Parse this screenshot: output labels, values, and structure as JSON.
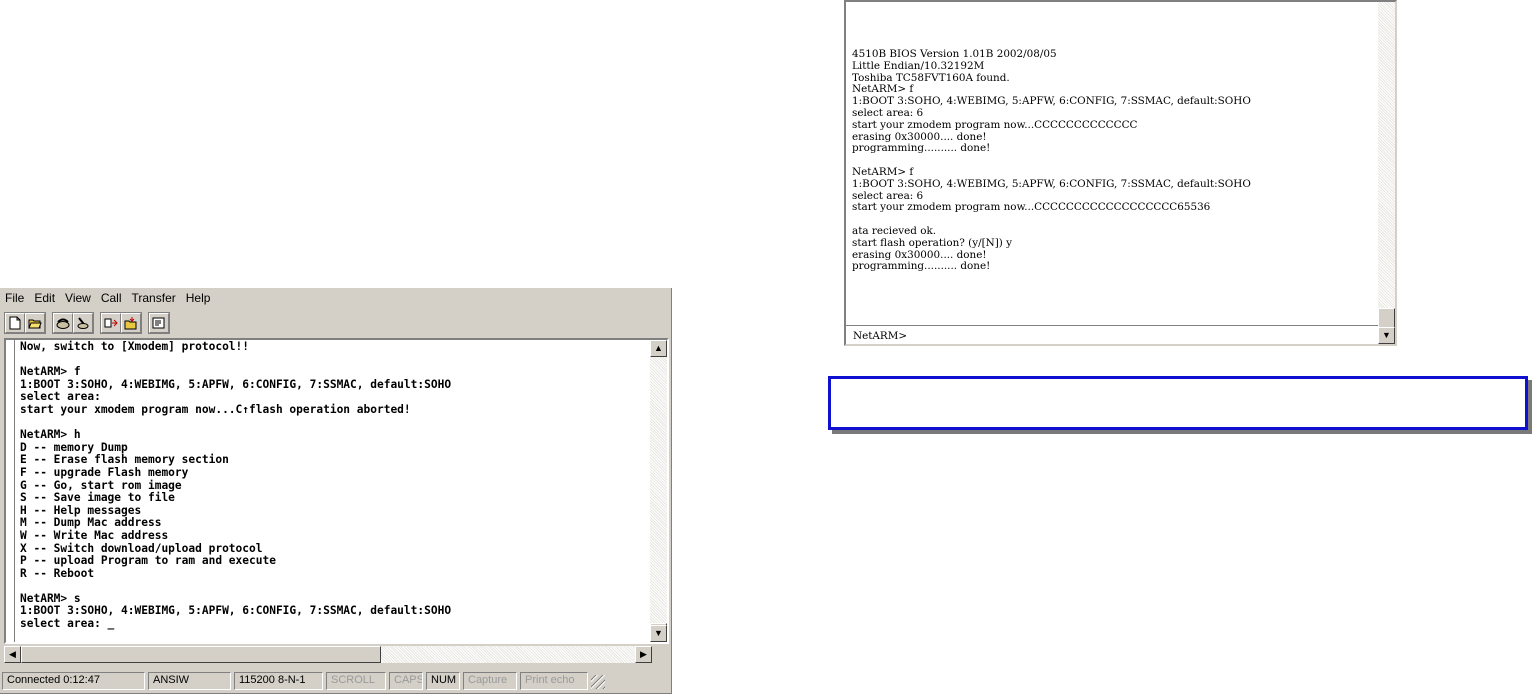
{
  "left_window": {
    "menu": [
      {
        "label": "File"
      },
      {
        "label": "Edit"
      },
      {
        "label": "View"
      },
      {
        "label": "Call"
      },
      {
        "label": "Transfer"
      },
      {
        "label": "Help"
      }
    ],
    "toolbar_icons": [
      "new-document-icon",
      "open-folder-icon",
      "phone-connect-icon",
      "phone-disconnect-icon",
      "send-icon",
      "receive-icon",
      "properties-icon"
    ],
    "terminal_lines": [
      "Now, switch to [Xmodem] protocol!!",
      "",
      "NetARM> f",
      "1:BOOT 3:SOHO, 4:WEBIMG, 5:APFW, 6:CONFIG, 7:SSMAC, default:SOHO",
      "select area:",
      "start your xmodem program now...C↑flash operation aborted!",
      "",
      "NetARM> h",
      "D -- memory Dump",
      "E -- Erase flash memory section",
      "F -- upgrade Flash memory",
      "G -- Go, start rom image",
      "S -- Save image to file",
      "H -- Help messages",
      "M -- Dump Mac address",
      "W -- Write Mac address",
      "X -- Switch download/upload protocol",
      "P -- upload Program to ram and execute",
      "R -- Reboot",
      "",
      "NetARM> s",
      "1:BOOT 3:SOHO, 4:WEBIMG, 5:APFW, 6:CONFIG, 7:SSMAC, default:SOHO",
      "select area: _"
    ],
    "status": {
      "connected": "Connected 0:12:47",
      "emulation": "ANSIW",
      "settings": "115200 8-N-1",
      "scroll": "SCROLL",
      "caps": "CAPS",
      "num": "NUM",
      "capture": "Capture",
      "print_echo": "Print echo"
    }
  },
  "right_window": {
    "terminal_lines": [
      "4510B BIOS Version 1.01B 2002/08/05",
      "Little Endian/10.32192M",
      "Toshiba TC58FVT160A found.",
      "NetARM> f",
      "1:BOOT 3:SOHO, 4:WEBIMG, 5:APFW, 6:CONFIG, 7:SSMAC, default:SOHO",
      "select area: 6",
      "start your zmodem program now...CCCCCCCCCCCCC",
      "erasing 0x30000.... done!",
      "programming.......... done!",
      "",
      "NetARM> f",
      "1:BOOT 3:SOHO, 4:WEBIMG, 5:APFW, 6:CONFIG, 7:SSMAC, default:SOHO",
      "select area: 6",
      "start your zmodem program now...CCCCCCCCCCCCCCCCCC65536",
      "",
      "ata recieved ok.",
      "start flash operation? (y/[N]) y",
      "erasing 0x30000.... done!",
      "programming.......... done!"
    ],
    "prompt": "NetARM>"
  },
  "colors": {
    "chrome": "#d4d0c8",
    "caption_border": "#1010d0"
  }
}
